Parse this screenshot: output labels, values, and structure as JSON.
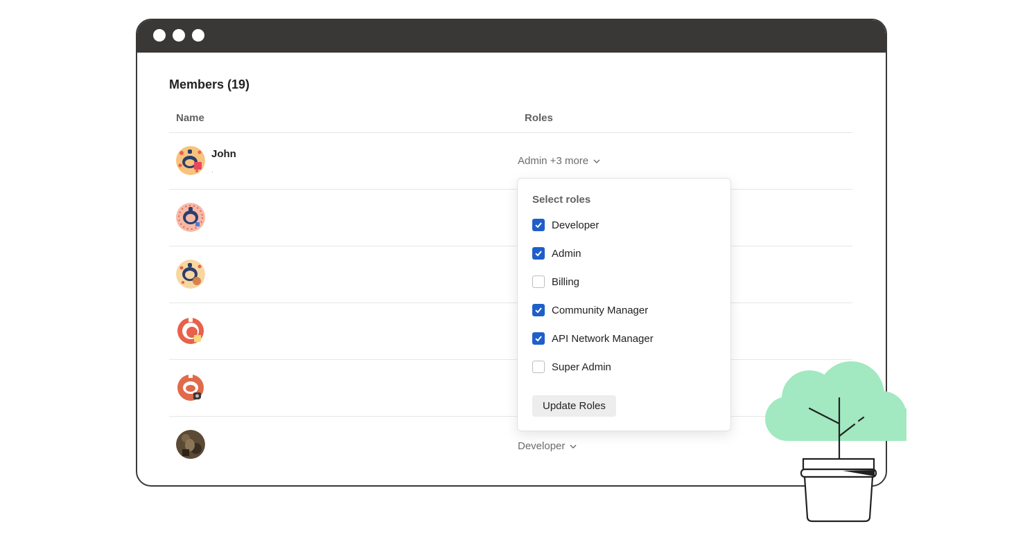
{
  "members": {
    "title": "Members (19)",
    "columns": {
      "name": "Name",
      "roles": "Roles"
    },
    "rows": [
      {
        "name": "John",
        "sub": ".",
        "roles": "Admin +3 more"
      },
      {
        "name": "",
        "sub": "",
        "roles": ""
      },
      {
        "name": "",
        "sub": "",
        "roles": ""
      },
      {
        "name": "",
        "sub": "",
        "roles": ""
      },
      {
        "name": "",
        "sub": "",
        "roles": ""
      },
      {
        "name": "",
        "sub": "",
        "roles": "Developer"
      }
    ]
  },
  "role_dropdown": {
    "title": "Select roles",
    "options": [
      {
        "label": "Developer",
        "checked": true
      },
      {
        "label": "Admin",
        "checked": true
      },
      {
        "label": "Billing",
        "checked": false
      },
      {
        "label": "Community Manager",
        "checked": true
      },
      {
        "label": "API Network Manager",
        "checked": true
      },
      {
        "label": "Super Admin",
        "checked": false
      }
    ],
    "button": "Update Roles"
  },
  "icons": {
    "window_controls": [
      "dot-icon",
      "dot-icon",
      "dot-icon"
    ],
    "role_chevron": "chevron-down-icon",
    "checkbox_check": "checkmark-icon",
    "illustration": "potted-plant-icon"
  },
  "colors": {
    "titlebar": "#3a3836",
    "checkbox_checked": "#1e5fc9",
    "button_bg": "#ededed",
    "foliage": "#a2e8c0"
  }
}
